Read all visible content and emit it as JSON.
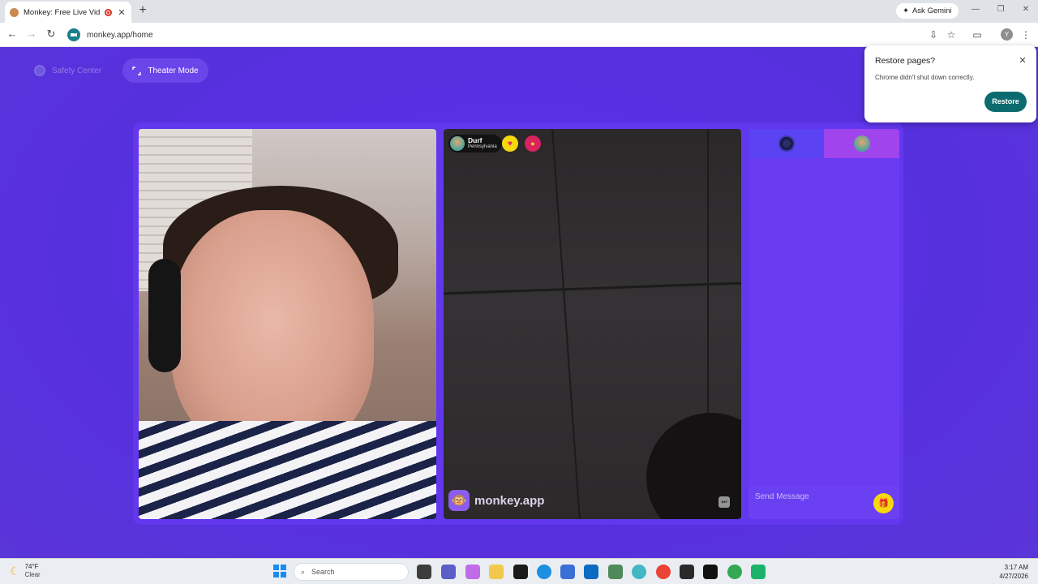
{
  "browser": {
    "tab_title": "Monkey: Free Live Video Ch",
    "tab_close": "✕",
    "new_tab": "+",
    "ask_gemini": "Ask Gemini",
    "url": "monkey.app/home",
    "profile_initial": "Y",
    "back": "←",
    "forward": "→",
    "reload": "↻",
    "minimize": "—",
    "maximize": "❐",
    "close": "✕"
  },
  "page": {
    "safety_center": "Safety Center",
    "theater_mode": "Theater Mode"
  },
  "remote": {
    "name": "Durf",
    "location": "Pennsylvania"
  },
  "brand": {
    "name": "monkey.app"
  },
  "chat": {
    "placeholder": "Send Message"
  },
  "restore_popup": {
    "title": "Restore pages?",
    "message": "Chrome didn't shut down correctly.",
    "button": "Restore",
    "close": "✕"
  },
  "taskbar": {
    "temp": "74°F",
    "condition": "Clear",
    "search": "Search",
    "time": "3:17 AM",
    "date": "4/27/2026"
  },
  "colors": {
    "page_bg": "#5a2fe0",
    "stage_bg": "#6237ee",
    "restore_btn": "#0b6b6e",
    "gift_yellow": "#f6d80c"
  }
}
